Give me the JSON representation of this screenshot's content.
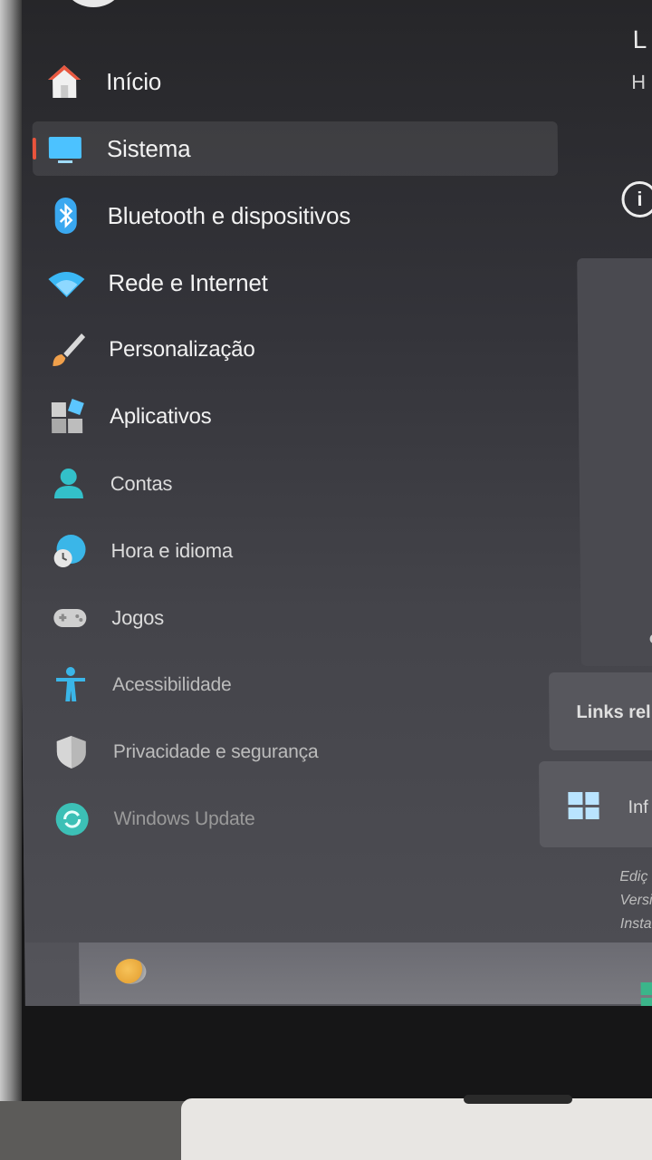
{
  "nav": {
    "items": [
      {
        "label": "Início",
        "icon": "home-icon"
      },
      {
        "label": "Sistema",
        "icon": "system-display-icon",
        "active": true
      },
      {
        "label": "Bluetooth e dispositivos",
        "icon": "bluetooth-icon"
      },
      {
        "label": "Rede e Internet",
        "icon": "wifi-icon"
      },
      {
        "label": "Personalização",
        "icon": "paintbrush-icon"
      },
      {
        "label": "Aplicativos",
        "icon": "apps-icon"
      },
      {
        "label": "Contas",
        "icon": "account-icon"
      },
      {
        "label": "Hora e idioma",
        "icon": "clock-globe-icon"
      },
      {
        "label": "Jogos",
        "icon": "gamepad-icon"
      },
      {
        "label": "Acessibilidade",
        "icon": "accessibility-icon"
      },
      {
        "label": "Privacidade e segurança",
        "icon": "shield-icon"
      },
      {
        "label": "Windows Update",
        "icon": "update-icon"
      }
    ]
  },
  "right": {
    "header_title": "L",
    "header_sub": "H",
    "links_label": "Links rel",
    "info_label": "Inf",
    "specs": [
      "Ediç",
      "Versi",
      "Instal"
    ]
  },
  "colors": {
    "accent": "#e9543c",
    "icon_blue": "#4cc2ff"
  }
}
